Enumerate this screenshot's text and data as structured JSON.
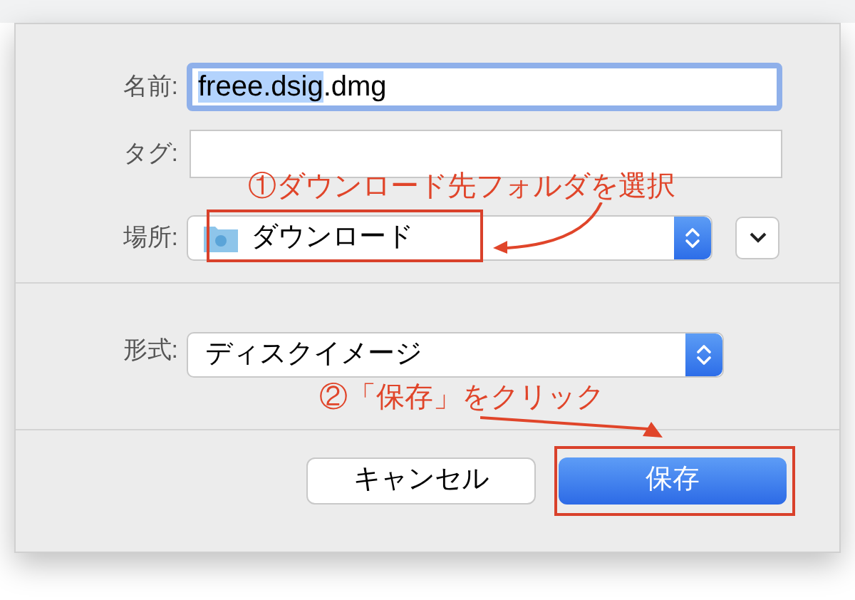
{
  "name_field": {
    "label": "名前:",
    "value_selected": "freee.dsig",
    "value_rest": ".dmg",
    "focused": true
  },
  "tags_field": {
    "label": "タグ:"
  },
  "location": {
    "label": "場所:",
    "value": "ダウンロード"
  },
  "format": {
    "label": "形式:",
    "value": "ディスクイメージ"
  },
  "buttons": [
    {
      "label": "キャンセル",
      "kind": "cancel"
    },
    {
      "label": "保存",
      "kind": "default"
    }
  ],
  "annotations": [
    {
      "text": "①ダウンロード先フォルダを選択"
    },
    {
      "text": "②「保存」をクリック"
    }
  ]
}
